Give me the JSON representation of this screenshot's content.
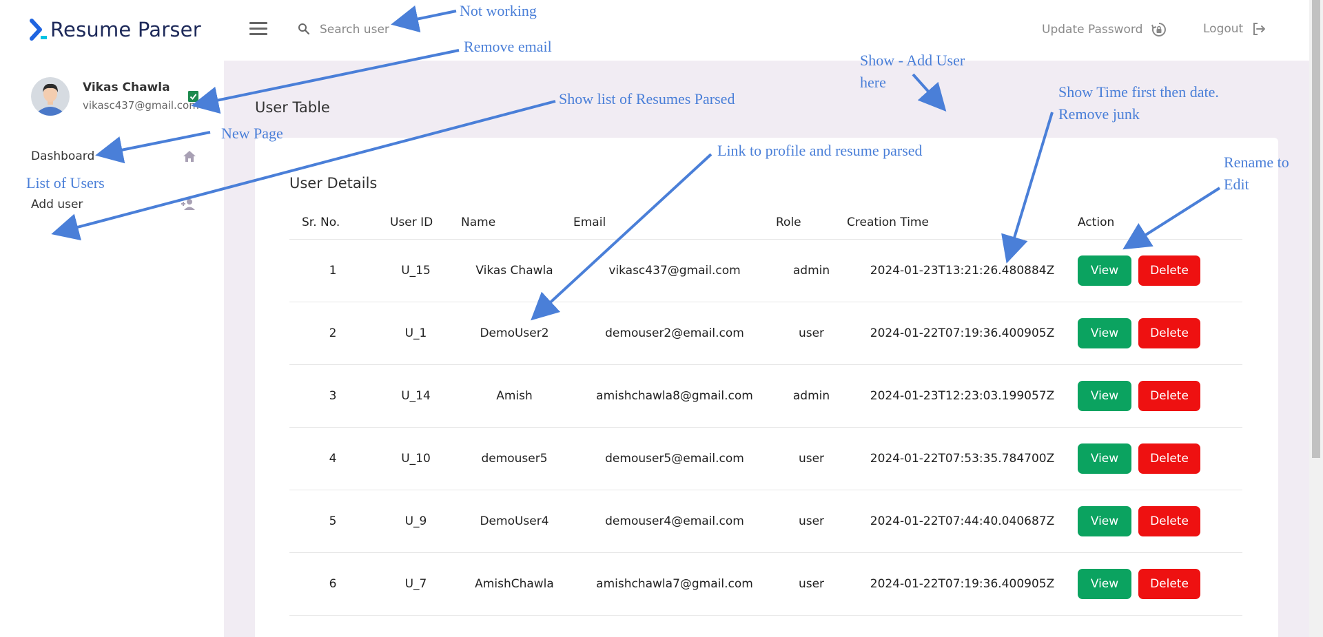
{
  "app": {
    "title": "Resume Parser"
  },
  "header": {
    "search_placeholder": "Search user",
    "update_password_label": "Update Password",
    "logout_label": "Logout"
  },
  "sidebar": {
    "user_name": "Vikas Chawla",
    "user_email": "vikasc437@gmail.com",
    "items": [
      {
        "label": "Dashboard",
        "icon": "home-icon"
      },
      {
        "label": "Add user",
        "icon": "add-user-icon"
      }
    ]
  },
  "main": {
    "page_title": "User Table",
    "card_title": "User Details",
    "table": {
      "columns": [
        "Sr. No.",
        "User ID",
        "Name",
        "Email",
        "Role",
        "Creation Time",
        "Action"
      ],
      "rows": [
        {
          "sr": "1",
          "id": "U_15",
          "name": "Vikas Chawla",
          "email": "vikasc437@gmail.com",
          "role": "admin",
          "created": "2024-01-23T13:21:26.480884Z"
        },
        {
          "sr": "2",
          "id": "U_1",
          "name": "DemoUser2",
          "email": "demouser2@email.com",
          "role": "user",
          "created": "2024-01-22T07:19:36.400905Z"
        },
        {
          "sr": "3",
          "id": "U_14",
          "name": "Amish",
          "email": "amishchawla8@gmail.com",
          "role": "admin",
          "created": "2024-01-23T12:23:03.199057Z"
        },
        {
          "sr": "4",
          "id": "U_10",
          "name": "demouser5",
          "email": "demouser5@email.com",
          "role": "user",
          "created": "2024-01-22T07:53:35.784700Z"
        },
        {
          "sr": "5",
          "id": "U_9",
          "name": "DemoUser4",
          "email": "demouser4@email.com",
          "role": "user",
          "created": "2024-01-22T07:44:40.040687Z"
        },
        {
          "sr": "6",
          "id": "U_7",
          "name": "AmishChawla",
          "email": "amishchawla7@gmail.com",
          "role": "user",
          "created": "2024-01-22T07:19:36.400905Z"
        }
      ],
      "view_label": "View",
      "delete_label": "Delete"
    }
  },
  "annotations": {
    "not_working": "Not working",
    "remove_email": "Remove email",
    "show_resumes": "Show list of Resumes Parsed",
    "new_page": "New Page",
    "list_users": "List of Users",
    "show_add_user_1": "Show - Add User",
    "show_add_user_2": "here",
    "time_first_1": "Show Time first then date.",
    "time_first_2": "Remove junk",
    "link_profile": "Link to profile and resume parsed",
    "rename_1": "Rename to",
    "rename_2": "Edit"
  },
  "colors": {
    "brand": "#1e2a5a",
    "view_button": "#0ba360",
    "delete_button": "#ee1111",
    "annotation": "#4a7fd8",
    "main_background": "#f1ecf3"
  }
}
